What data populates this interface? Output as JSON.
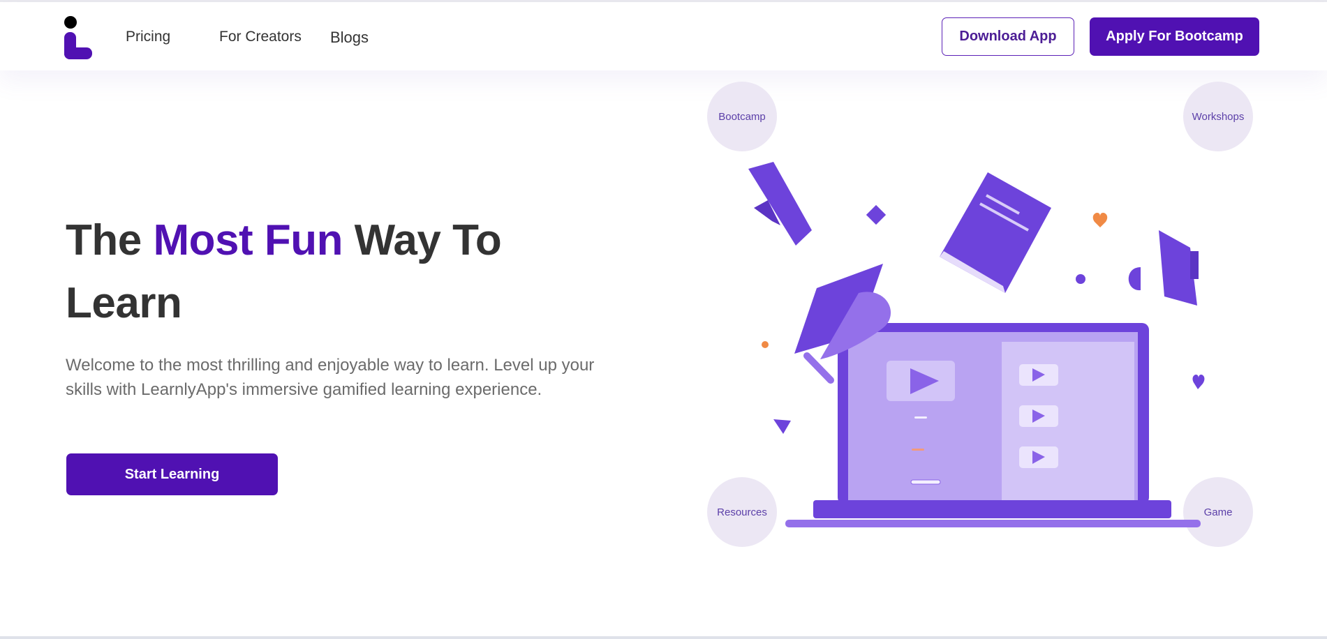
{
  "nav": {
    "links": [
      {
        "label": "Pricing"
      },
      {
        "label": "For Creators"
      },
      {
        "label": "Blogs"
      }
    ],
    "download_label": "Download App",
    "apply_label": "Apply For Bootcamp"
  },
  "hero": {
    "title_part1": "The ",
    "title_accent": "Most Fun",
    "title_part2": " Way To Learn",
    "description": "Welcome to the most thrilling and enjoyable way to learn. Level up your skills with LearnlyApp's immersive gamified learning experience.",
    "cta_label": "Start Learning"
  },
  "badges": {
    "bootcamp": "Bootcamp",
    "workshops": "Workshops",
    "resources": "Resources",
    "game": "Game"
  },
  "colors": {
    "brand": "#5011b2",
    "illustration_purple": "#6d43db",
    "illustration_light": "#b9a3f2",
    "accent_orange": "#f08a45",
    "badge_bg": "#ece7f4"
  },
  "icons": [
    "logo-icon",
    "diploma-icon",
    "book-icon",
    "megaphone-icon",
    "graduation-cap-icon",
    "laptop-icon",
    "play-icon",
    "heart-icon"
  ]
}
